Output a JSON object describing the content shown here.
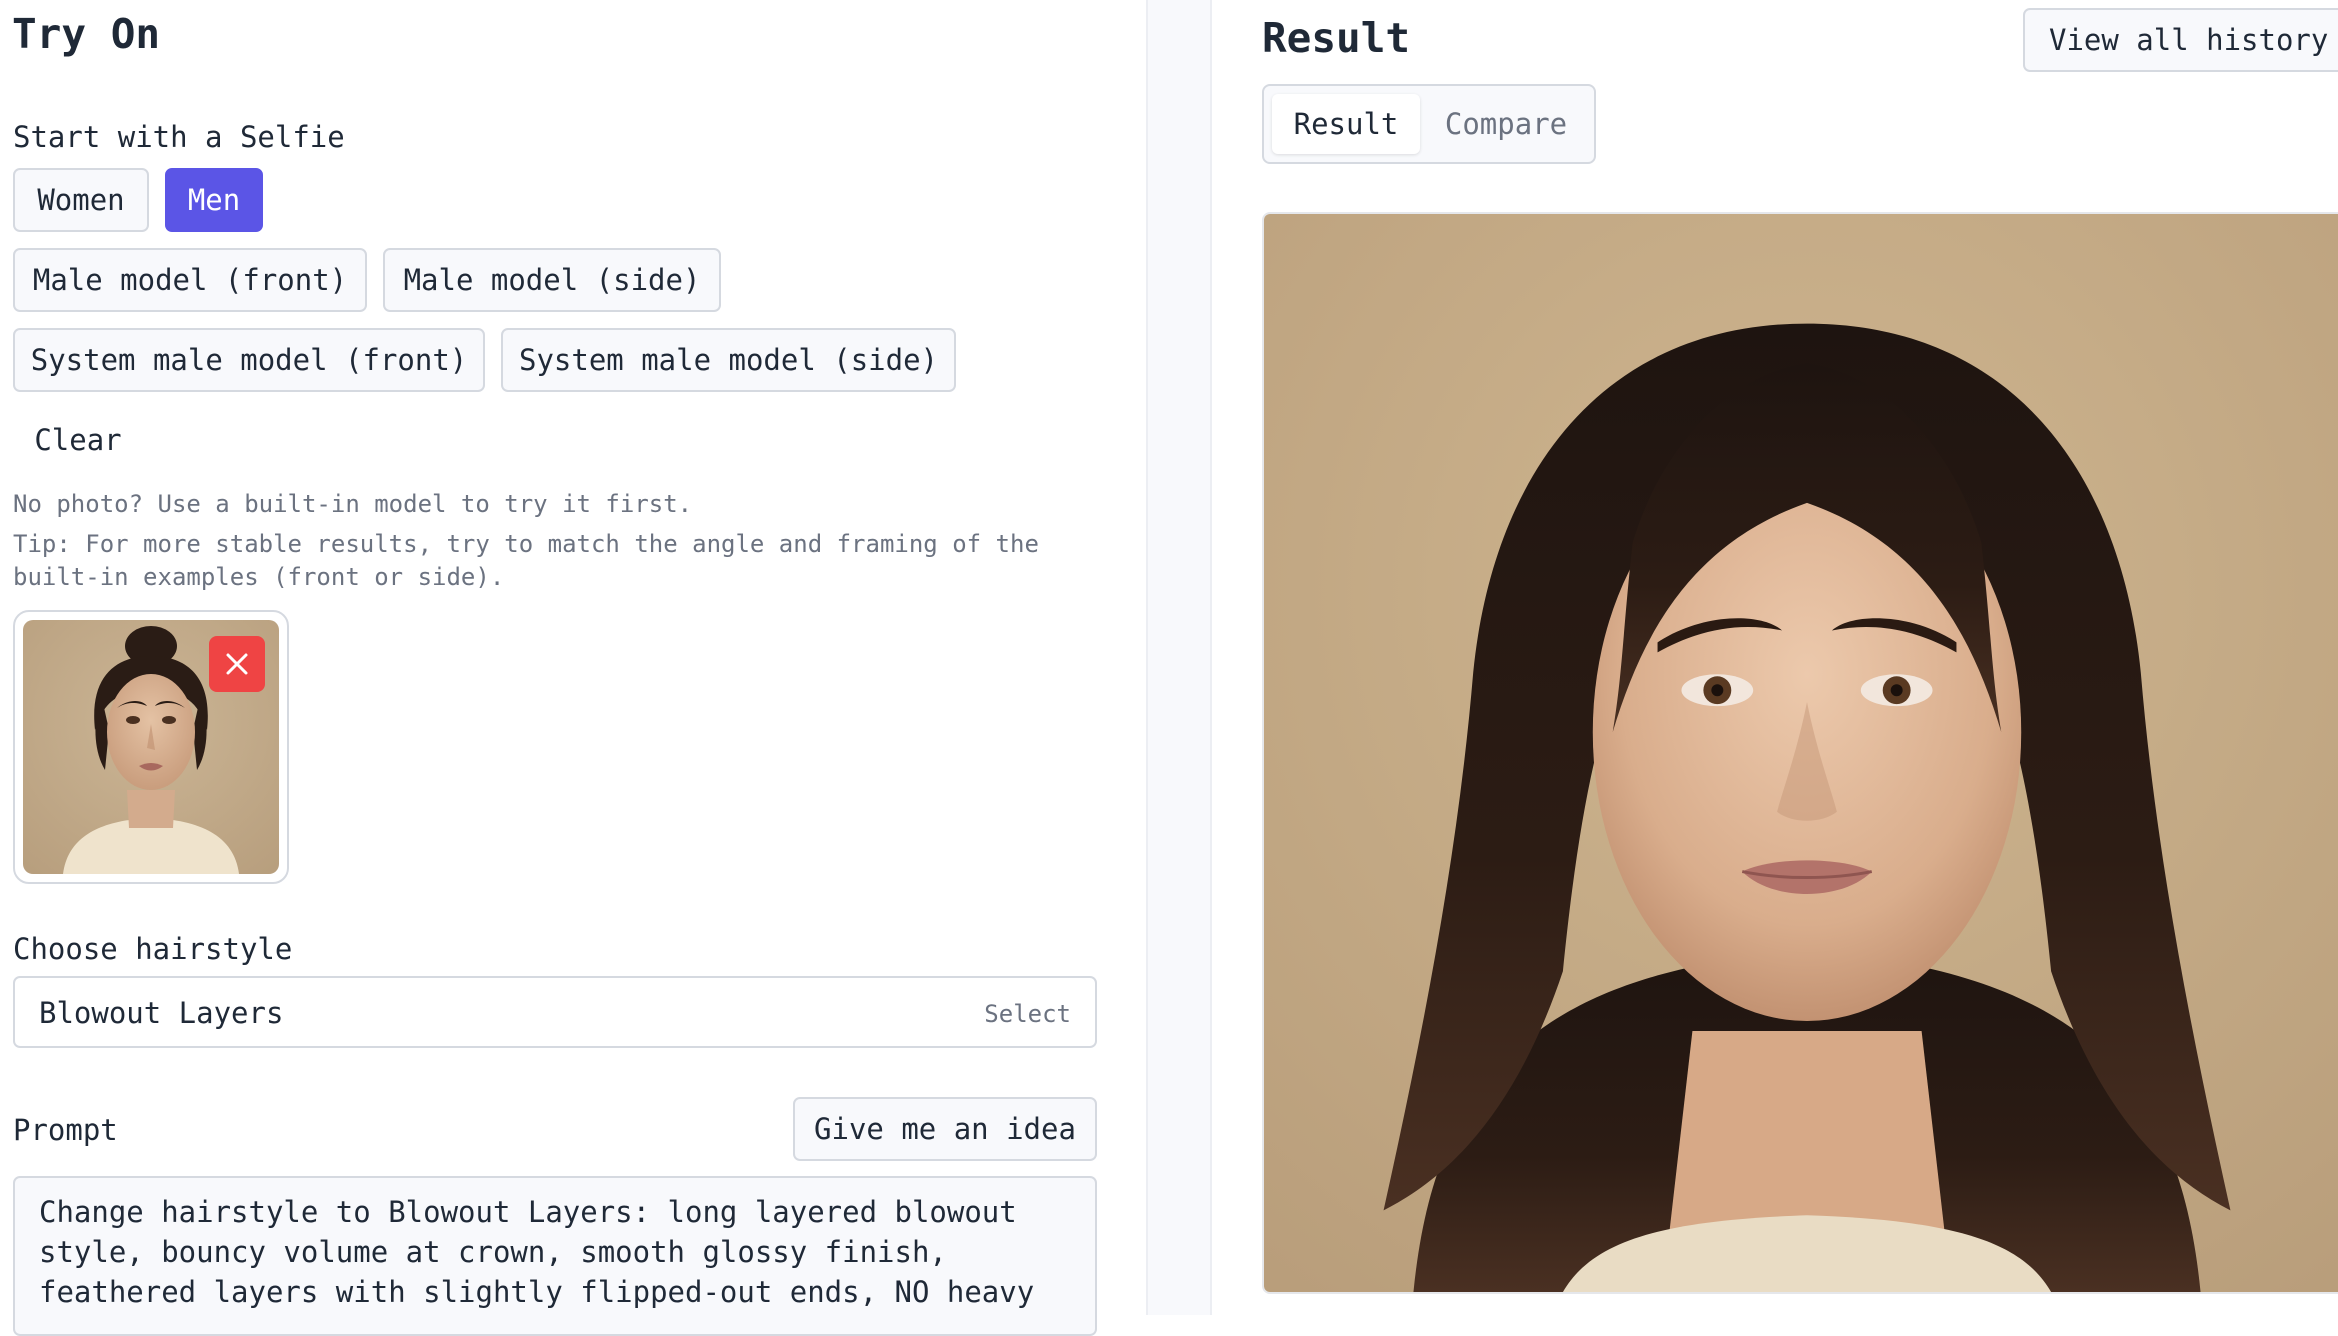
{
  "left": {
    "title": "Try On",
    "selfie_section_label": "Start with a Selfie",
    "gender_buttons": [
      "Women",
      "Men"
    ],
    "gender_selected": "Men",
    "model_buttons": [
      "Male model (front)",
      "Male model (side)",
      "System male model (front)",
      "System male model (side)"
    ],
    "clear_label": "Clear",
    "hint_no_photo": "No photo? Use a built-in model to try it first.",
    "hint_tip_line1": "Tip: For more stable results, try to match the angle and framing of the",
    "hint_tip_line2": "built-in examples (front or side).",
    "hairstyle_label": "Choose hairstyle",
    "hairstyle_value": "Blowout Layers",
    "hairstyle_select_hint": "Select",
    "prompt_label": "Prompt",
    "idea_button": "Give me an idea",
    "prompt_text": "Change hairstyle to Blowout Layers: long layered blowout\nstyle, bouncy volume at crown, smooth glossy finish,\nfeathered layers with slightly flipped-out ends, NO heavy"
  },
  "right": {
    "title": "Result",
    "history_button": "View all history",
    "tabs": [
      "Result",
      "Compare"
    ],
    "active_tab": "Result"
  },
  "colors": {
    "accent": "#5b55e6",
    "remove": "#ef4444",
    "border": "#d5d9e0",
    "muted_text": "#6b7280"
  },
  "icons": {
    "remove": "close-icon"
  }
}
